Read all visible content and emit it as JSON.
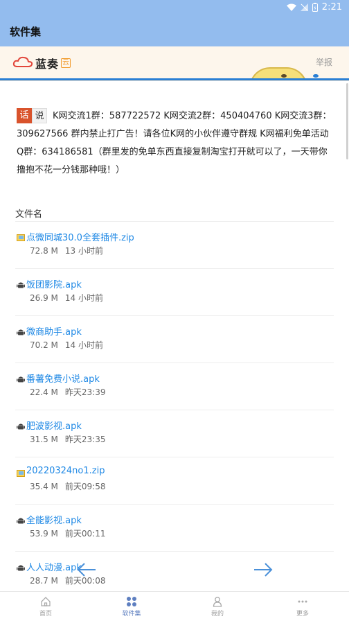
{
  "status_bar": {
    "time": "2:21"
  },
  "app_bar": {
    "title": "软件集"
  },
  "banner": {
    "brand": "蓝奏",
    "brand_badge": "云",
    "report_label": "举报"
  },
  "notice": {
    "badge_left": "话",
    "badge_right": "说",
    "text": "K网交流1群：587722572 K网交流2群：450404760 K网交流3群：309627566 群内禁止打广告！请各位K网的小伙伴遵守群规 K网福利免单活动Q群：634186581（群里发的免单东西直接复制淘宝打开就可以了，一天带你撸抱不花一分钱那种哦！）"
  },
  "list": {
    "header": "文件名",
    "files": [
      {
        "name": "点微同城30.0全套插件.zip",
        "size": "72.8 M",
        "time": "13 小时前",
        "icon": "zip-icon"
      },
      {
        "name": "饭团影院.apk",
        "size": "26.9 M",
        "time": "14 小时前",
        "icon": "android-icon"
      },
      {
        "name": "微商助手.apk",
        "size": "70.2 M",
        "time": "14 小时前",
        "icon": "android-icon"
      },
      {
        "name": "番薯免费小说.apk",
        "size": "22.4 M",
        "time": "昨天23:39",
        "icon": "android-icon"
      },
      {
        "name": "肥波影视.apk",
        "size": "31.5 M",
        "time": "昨天23:35",
        "icon": "android-icon"
      },
      {
        "name": "20220324no1.zip",
        "size": "35.4 M",
        "time": "前天09:58",
        "icon": "zip-icon"
      },
      {
        "name": "全能影视.apk",
        "size": "53.9 M",
        "time": "前天00:11",
        "icon": "android-icon"
      },
      {
        "name": "人人动漫.apk",
        "size": "28.7 M",
        "time": "前天00:08",
        "icon": "android-icon"
      }
    ]
  },
  "pager": {
    "prev_icon": "arrow-left-icon",
    "next_icon": "arrow-right-icon"
  },
  "bottom_nav": {
    "items": [
      {
        "label": "首页",
        "icon": "home-icon"
      },
      {
        "label": "软件集",
        "icon": "grid-icon"
      },
      {
        "label": "我的",
        "icon": "user-icon"
      },
      {
        "label": "更多",
        "icon": "more-icon"
      }
    ],
    "active_index": 1
  },
  "colors": {
    "appbar": "#93bcee",
    "link": "#1e88e5",
    "badge": "#d9532c",
    "active_nav": "#5e7fc0"
  }
}
